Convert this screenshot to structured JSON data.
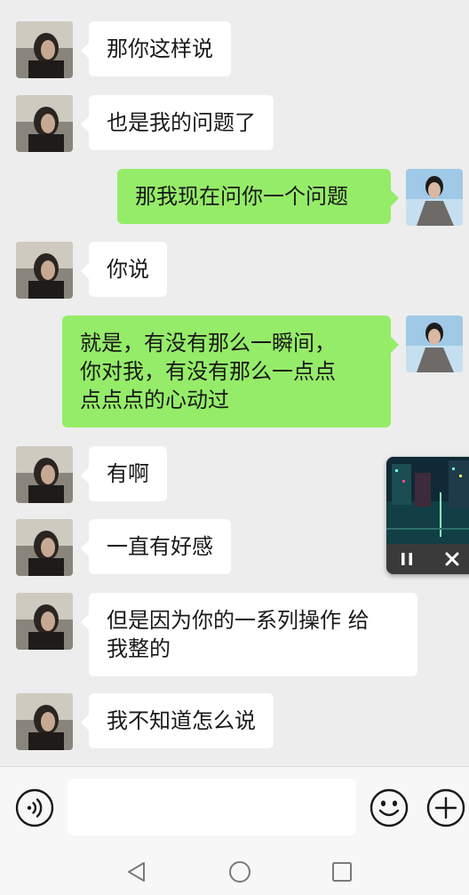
{
  "messages": [
    {
      "side": "left",
      "lines": [
        "那你这样说"
      ]
    },
    {
      "side": "left",
      "lines": [
        "也是我的问题了"
      ]
    },
    {
      "side": "right",
      "lines": [
        "那我现在问你一个问题"
      ]
    },
    {
      "side": "left",
      "lines": [
        "你说"
      ]
    },
    {
      "side": "right",
      "lines": [
        "就是，有没有那么一瞬间，",
        "你对我，有没有那么一点点",
        "点点点的心动过"
      ]
    },
    {
      "side": "left",
      "lines": [
        "有啊"
      ]
    },
    {
      "side": "left",
      "lines": [
        "一直有好感"
      ]
    },
    {
      "side": "left",
      "lines": [
        "但是因为你的一系列操作 给",
        "我整的"
      ]
    },
    {
      "side": "left",
      "lines": [
        "我不知道怎么说"
      ]
    }
  ],
  "floating_player": {
    "state": "playing",
    "pause_icon": "pause-icon",
    "close_icon": "close-icon"
  },
  "input_bar": {
    "text": "",
    "voice_icon": "voice-icon",
    "emoji_icon": "emoji-icon",
    "plus_icon": "plus-icon"
  },
  "nav_bar": {
    "back_icon": "back-icon",
    "home_icon": "home-icon",
    "recents_icon": "recents-icon"
  },
  "colors": {
    "sent_bubble": "#95ec69",
    "received_bubble": "#ffffff",
    "background": "#ededed"
  }
}
